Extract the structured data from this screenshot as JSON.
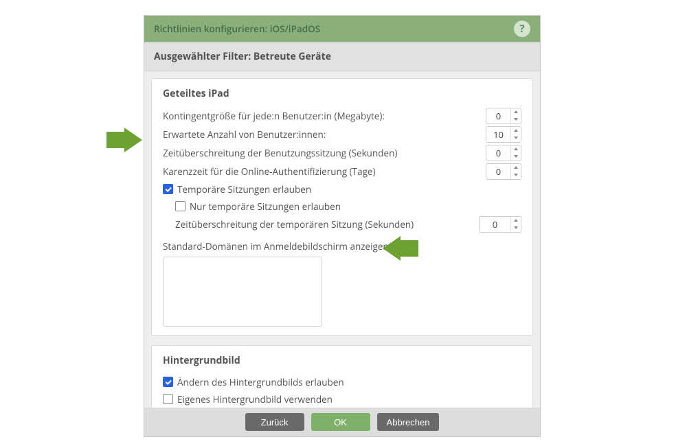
{
  "colors": {
    "header_bg": "#8aaf7b",
    "accent_green": "#7fb069",
    "arrow_green": "#6da232",
    "checkbox_blue": "#2962d9",
    "button_gray": "#6a6a6a"
  },
  "header": {
    "title": "Richtlinien konfigurieren: iOS/iPadOS",
    "help_glyph": "?"
  },
  "filter": {
    "text": "Ausgewählter Filter: Betreute Geräte"
  },
  "shared_ipad": {
    "title": "Geteiltes iPad",
    "quota_label": "Kontingentgröße für jede:n Benutzer:in (Megabyte):",
    "quota_value": "0",
    "expected_users_label": "Erwartete Anzahl von Benutzer:innen:",
    "expected_users_value": "10",
    "session_timeout_label": "Zeitüberschreitung der Benutzungssitzung (Sekunden)",
    "session_timeout_value": "0",
    "grace_label": "Karenzzeit für die Online-Authentifizierung (Tage)",
    "grace_value": "0",
    "allow_temp_label": "Temporäre Sitzungen erlauben",
    "allow_temp_checked": true,
    "only_temp_label": "Nur temporäre Sitzungen erlauben",
    "only_temp_checked": false,
    "temp_timeout_label": "Zeitüberschreitung der temporären Sitzung (Sekunden)",
    "temp_timeout_value": "0",
    "domains_label": "Standard-Domänen im Anmeldebildschirm anzeigen:"
  },
  "wallpaper": {
    "title": "Hintergrundbild",
    "allow_change_label": "Ändern des Hintergrundbilds erlauben",
    "allow_change_checked": true,
    "use_custom_label": "Eigenes Hintergrundbild verwenden",
    "use_custom_checked": false
  },
  "footer": {
    "back": "Zurück",
    "ok": "OK",
    "cancel": "Abbrechen"
  }
}
